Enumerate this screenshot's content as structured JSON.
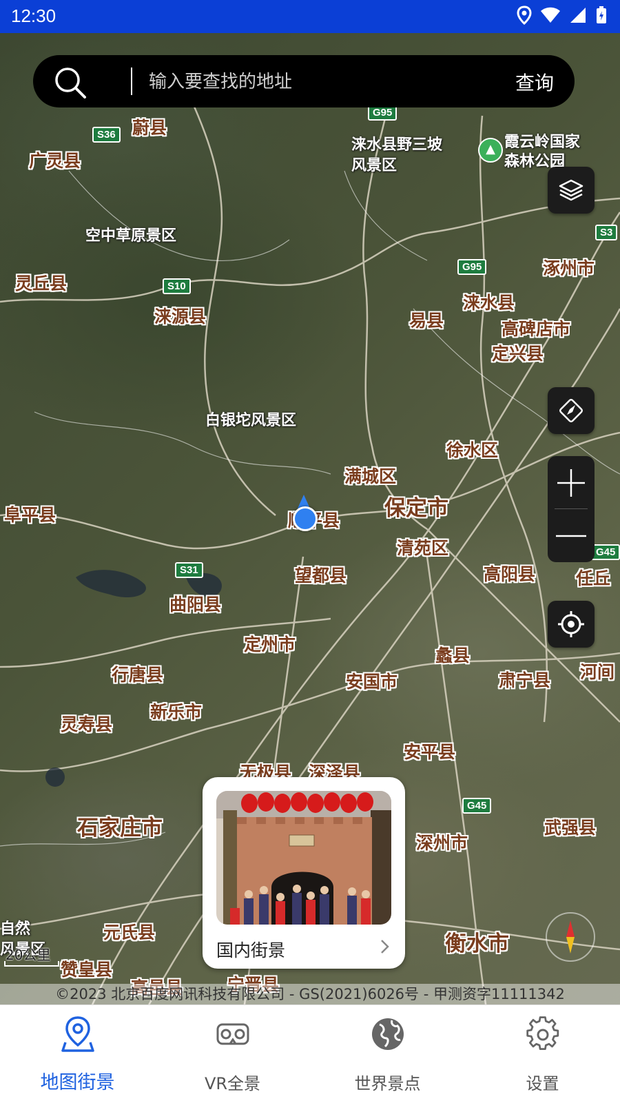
{
  "status_bar": {
    "time": "12:30"
  },
  "search": {
    "placeholder": "输入要查找的地址",
    "button": "查询"
  },
  "map": {
    "places": [
      {
        "name": "蔚县",
        "style": "brown"
      },
      {
        "name": "广灵县",
        "style": "brown"
      },
      {
        "name": "涞水县野三坡",
        "style": "white"
      },
      {
        "name": "风景区",
        "style": "white"
      },
      {
        "name": "霞云岭国家",
        "style": "white"
      },
      {
        "name": "森林公园",
        "style": "white"
      },
      {
        "name": "空中草原景区",
        "style": "white"
      },
      {
        "name": "灵丘县",
        "style": "brown"
      },
      {
        "name": "涞源县",
        "style": "brown"
      },
      {
        "name": "涞水县",
        "style": "brown"
      },
      {
        "name": "易县",
        "style": "brown"
      },
      {
        "name": "涿州市",
        "style": "brown"
      },
      {
        "name": "高碑店市",
        "style": "brown"
      },
      {
        "name": "定兴县",
        "style": "brown"
      },
      {
        "name": "白银坨风景区",
        "style": "white"
      },
      {
        "name": "徐水区",
        "style": "brown"
      },
      {
        "name": "满城区",
        "style": "brown"
      },
      {
        "name": "保定市",
        "style": "city"
      },
      {
        "name": "阜平县",
        "style": "brown"
      },
      {
        "name": "顺平县",
        "style": "brown"
      },
      {
        "name": "清苑区",
        "style": "brown"
      },
      {
        "name": "望都县",
        "style": "brown"
      },
      {
        "name": "高阳县",
        "style": "brown"
      },
      {
        "name": "任丘",
        "style": "brown"
      },
      {
        "name": "曲阳县",
        "style": "brown"
      },
      {
        "name": "定州市",
        "style": "brown"
      },
      {
        "name": "蠡县",
        "style": "brown"
      },
      {
        "name": "行唐县",
        "style": "brown"
      },
      {
        "name": "安国市",
        "style": "brown"
      },
      {
        "name": "肃宁县",
        "style": "brown"
      },
      {
        "name": "河间",
        "style": "brown"
      },
      {
        "name": "新乐市",
        "style": "brown"
      },
      {
        "name": "灵寿县",
        "style": "brown"
      },
      {
        "name": "安平县",
        "style": "brown"
      },
      {
        "name": "无极县",
        "style": "brown"
      },
      {
        "name": "深泽县",
        "style": "brown"
      },
      {
        "name": "石家庄市",
        "style": "city"
      },
      {
        "name": "深州市",
        "style": "brown"
      },
      {
        "name": "武强县",
        "style": "brown"
      },
      {
        "name": "元氏县",
        "style": "brown"
      },
      {
        "name": "衡水市",
        "style": "city"
      },
      {
        "name": "赞皇县",
        "style": "brown"
      },
      {
        "name": "自然",
        "style": "white"
      },
      {
        "name": "风景区",
        "style": "white"
      },
      {
        "name": "高邑县",
        "style": "brown"
      },
      {
        "name": "宁晋县",
        "style": "brown"
      }
    ],
    "road_shields": [
      "S36",
      "G95",
      "S10",
      "G95",
      "S31",
      "G45",
      "G45",
      "S3"
    ],
    "scale": "20公里",
    "copyright": "©2023 北京百度网讯科技有限公司 - GS(2021)6026号 - 甲测资字11111342"
  },
  "streetview_card": {
    "label": "国内街景"
  },
  "bottom_nav": {
    "tabs": [
      {
        "label": "地图街景",
        "icon": "map-pin-icon",
        "active": true
      },
      {
        "label": "VR全景",
        "icon": "vr-headset-icon",
        "active": false
      },
      {
        "label": "世界景点",
        "icon": "globe-icon",
        "active": false
      },
      {
        "label": "设置",
        "icon": "gear-icon",
        "active": false
      }
    ]
  },
  "colors": {
    "status_bar": "#0b3fd6",
    "accent": "#1f62e0",
    "place_label": "#7a3d1e",
    "road_shield": "#1e7c3f"
  }
}
